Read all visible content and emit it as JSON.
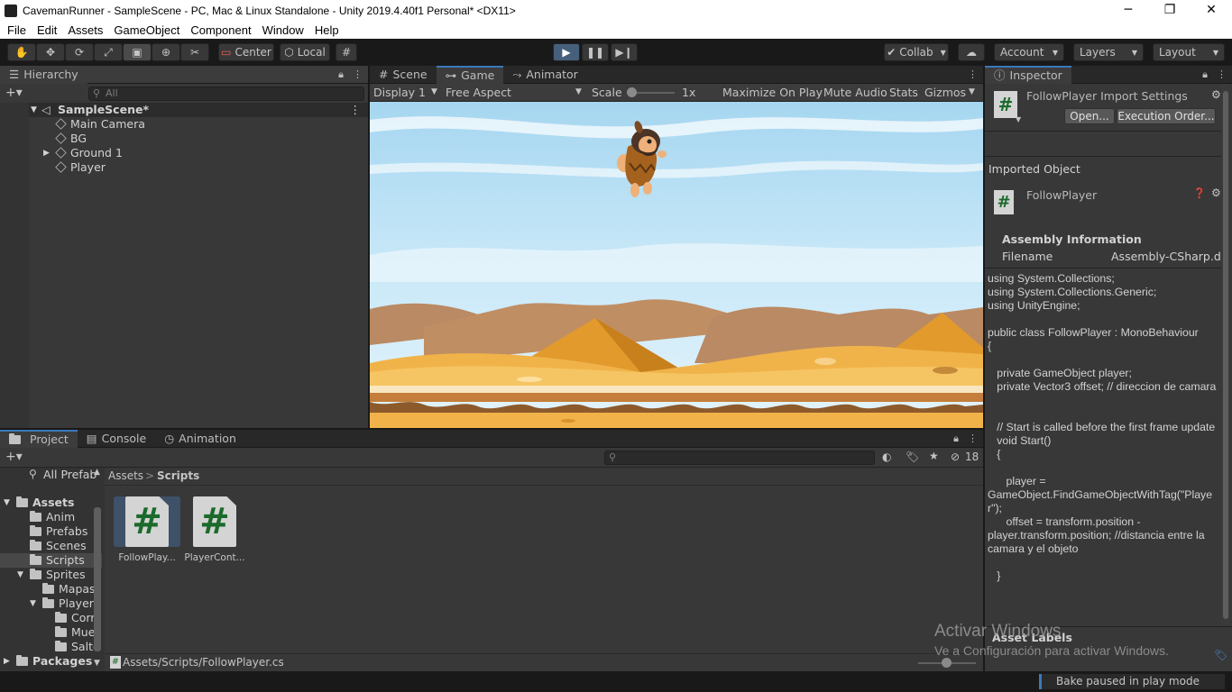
{
  "window": {
    "title": "CavemanRunner - SampleScene - PC, Mac & Linux Standalone - Unity 2019.4.40f1 Personal* <DX11>",
    "minimize": "─",
    "maximize": "❐",
    "close": "✕"
  },
  "menu": [
    "File",
    "Edit",
    "Assets",
    "GameObject",
    "Component",
    "Window",
    "Help"
  ],
  "toolbar": {
    "pivot": "Center",
    "space": "Local",
    "collab": "Collab",
    "account": "Account",
    "layers": "Layers",
    "layout": "Layout"
  },
  "hierarchy": {
    "tab": "Hierarchy",
    "search_placeholder": "All",
    "scene": "SampleScene*",
    "items": [
      "Main Camera",
      "BG",
      "Ground 1",
      "Player"
    ]
  },
  "gameview": {
    "tabs": [
      "Scene",
      "Game",
      "Animator"
    ],
    "display": "Display 1",
    "aspect": "Free Aspect",
    "scale_label": "Scale",
    "scale_value": "1x",
    "maximize": "Maximize On Play",
    "mute": "Mute Audio",
    "stats": "Stats",
    "gizmos": "Gizmos"
  },
  "inspector": {
    "tab": "Inspector",
    "header": "FollowPlayer Import Settings",
    "open_button": "Open...",
    "exec_button": "Execution Order...",
    "imported_object": "Imported Object",
    "object_name": "FollowPlayer",
    "assembly_info": "Assembly Information",
    "filename_label": "Filename",
    "filename_value": "Assembly-CSharp.dl",
    "code": "using System.Collections;\nusing System.Collections.Generic;\nusing UnityEngine;\n\npublic class FollowPlayer : MonoBehaviour\n{\n\n   private GameObject player;\n   private Vector3 offset; // direccion de camara\n\n\n   // Start is called before the first frame update\n   void Start()\n   {\n\n      player =\nGameObject.FindGameObjectWithTag(\"Playe\nr\");\n      offset = transform.position -\nplayer.transform.position; //distancia entre la camara y el objeto\n\n   }",
    "asset_labels": "Asset Labels"
  },
  "project": {
    "tabs": [
      "Project",
      "Console",
      "Animation"
    ],
    "all_prefabs": "All Prefab",
    "tree": [
      {
        "label": "Assets",
        "bold": true
      },
      {
        "label": "Anim"
      },
      {
        "label": "Prefabs"
      },
      {
        "label": "Scenes"
      },
      {
        "label": "Scripts"
      },
      {
        "label": "Sprites"
      },
      {
        "label": "Mapas"
      },
      {
        "label": "Player"
      },
      {
        "label": "Corr"
      },
      {
        "label": "Mue"
      },
      {
        "label": "Salto"
      },
      {
        "label": "Packages",
        "bold": true
      }
    ],
    "breadcrumb_root": "Assets",
    "breadcrumb_sep": ">",
    "breadcrumb_current": "Scripts",
    "hidden_count": "18",
    "assets": [
      "FollowPlay...",
      "PlayerCont..."
    ],
    "path": "Assets/Scripts/FollowPlayer.cs"
  },
  "watermark": {
    "line1": "Activar Windows",
    "line2": "Ve a Configuración para activar Windows."
  },
  "status": {
    "bake": "Bake paused in play mode"
  },
  "colors": {
    "accent": "#3a79bb",
    "play_active": "#46607c",
    "sky": "#bfe4f7",
    "sand": "#f3c25d"
  }
}
